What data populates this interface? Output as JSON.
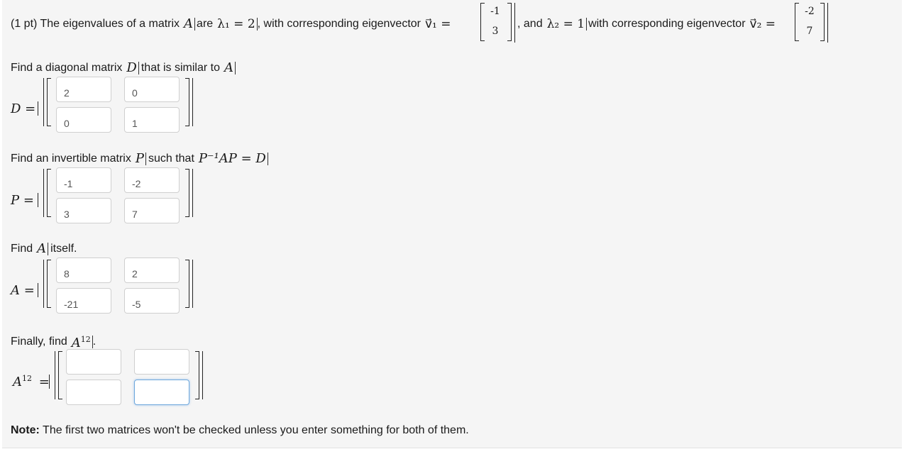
{
  "problem": {
    "prefix": "(1 pt) The eigenvalues of a matrix",
    "matrix_name": "A",
    "are": "are",
    "lambda1_expr": "λ₁ = 2",
    "with_eig_1": ", with corresponding eigenvector",
    "v1_label": "v⃗₁ =",
    "v1": [
      "-1",
      "3"
    ],
    "and": ", and",
    "lambda2_expr": "λ₂ = 1",
    "with_eig_2": "with corresponding eigenvector",
    "v2_label": "v⃗₂ =",
    "v2": [
      "-2",
      "7"
    ]
  },
  "part_d": {
    "prompt": "Find a diagonal matrix",
    "var": "D",
    "suffix": "that is similar to",
    "var2": "A",
    "end": ".",
    "label": "D =",
    "values": [
      "2",
      "0",
      "0",
      "1"
    ]
  },
  "part_p": {
    "prompt": "Find an invertible matrix",
    "var": "P",
    "suffix": "such that",
    "equation": "P⁻¹AP = D",
    "end": ".",
    "label": "P =",
    "values": [
      "-1",
      "-2",
      "3",
      "7"
    ]
  },
  "part_a": {
    "prompt": "Find",
    "var": "A",
    "suffix": "itself.",
    "label": "A =",
    "values": [
      "8",
      "2",
      "-21",
      "-5"
    ]
  },
  "part_a12": {
    "prompt": "Finally, find",
    "var": "A",
    "exp": "12",
    "end": ".",
    "label_var": "A",
    "label_exp": "12",
    "label_eq": "=",
    "values": [
      "",
      "",
      "",
      ""
    ]
  },
  "note": {
    "bold": "Note:",
    "text": "The first two matrices won't be checked unless you enter something for both of them."
  }
}
